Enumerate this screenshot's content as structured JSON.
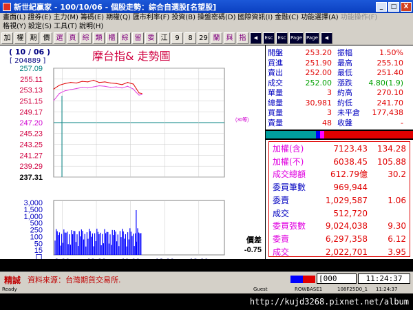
{
  "window": {
    "title": "新世紀贏家 - 100/10/06 - 個股走勢：綜合自選股[名望股]",
    "min": "_",
    "max": "□",
    "close": "X"
  },
  "menu": {
    "row1": [
      "畫面(L)",
      "證券(E)",
      "主力(M)",
      "籌碼(E)",
      "期權(Q)",
      "匯市利率(F)",
      "投資(B)",
      "操盤密碼(D)",
      "國際資訊(I)",
      "金融(C)",
      "功能選擇(A)",
      "功能操作(F)"
    ],
    "row2": [
      "格視(Y)",
      "設定(S)",
      "工具(T)",
      "說明(H)"
    ]
  },
  "toolbar": [
    "加",
    "權",
    "期",
    "價",
    "選",
    "頁",
    "綜",
    "類",
    "櫃",
    "綜",
    "留",
    "委",
    "江",
    "9",
    "8",
    "29",
    "蘭",
    "與",
    "指",
    "◀",
    "Esc",
    "Esc",
    "Page",
    "Page",
    "◀"
  ],
  "chart_header": {
    "date": "( 10 / 06 )",
    "code": "[ 204889 ]",
    "title": "摩台指&  走勢圖",
    "diff_label": "價差",
    "diff_value": "-0.75",
    "ref_label": "(30等)",
    "footer_left": "精誠"
  },
  "chart_data": {
    "type": "line",
    "title": "摩台指&  走勢圖",
    "ylabel": "",
    "xlabel": "",
    "ylim": [
      237.31,
      257.09
    ],
    "y_ticks": [
      "257.09",
      "255.11",
      "253.13",
      "251.15",
      "249.17",
      "247.20",
      "245.23",
      "243.25",
      "241.27",
      "239.29",
      "237.31"
    ],
    "reference": 247.2,
    "x_ticks": [
      "9:00",
      "10:00",
      "11:00",
      "12:00",
      "13:00"
    ],
    "x_range": [
      "8:45",
      "13:45"
    ],
    "series": [
      {
        "x": [
          "8:45",
          "8:55",
          "9:05",
          "9:15",
          "9:25",
          "9:35",
          "9:45",
          "9:55",
          "10:05",
          "10:15",
          "10:25",
          "10:35",
          "10:45",
          "10:55",
          "11:05",
          "11:10",
          "11:15",
          "11:20"
        ],
        "values": [
          253.3,
          254.0,
          254.3,
          254.5,
          254.4,
          254.7,
          254.6,
          254.9,
          254.5,
          254.6,
          254.4,
          254.3,
          254.1,
          254.5,
          254.2,
          253.4,
          252.6,
          252.5
        ],
        "color": "#e00000"
      },
      {
        "x": [
          "8:45",
          "8:55",
          "9:05",
          "9:15",
          "9:25",
          "9:35",
          "9:45",
          "9:55",
          "10:05",
          "10:15",
          "10:25",
          "10:35",
          "10:45",
          "10:55",
          "11:05",
          "11:10",
          "11:15",
          "11:20"
        ],
        "values": [
          251.2,
          252.5,
          253.0,
          253.2,
          253.4,
          253.6,
          253.5,
          253.7,
          253.9,
          253.8,
          253.6,
          253.7,
          253.5,
          253.8,
          253.3,
          252.7,
          252.2,
          252.3
        ],
        "color": "#e040e0"
      }
    ],
    "volume": {
      "y_ticks": [
        "3,000",
        "1,500",
        "1,000",
        "500",
        "250",
        "100",
        "50",
        "15",
        "口"
      ],
      "series_color": "#0000ff"
    }
  },
  "quote": {
    "rows": [
      {
        "l1": "開盤",
        "v1": "253.20",
        "l2": "振幅",
        "v2": "1.50%",
        "c": "#e00000"
      },
      {
        "l1": "買進",
        "v1": "251.90",
        "l2": "最高",
        "v2": "255.10",
        "c": "#e00000"
      },
      {
        "l1": "賣出",
        "v1": "252.00",
        "l2": "最低",
        "v2": "251.40",
        "c": "#e00000"
      },
      {
        "l1": "成交",
        "v1": "252.00",
        "l2": "漲跌",
        "v2": "4.80(1.9)",
        "c": "#00a000"
      },
      {
        "l1": "單量",
        "v1": "3",
        "l2": "約高",
        "v2": "270.10",
        "c": "#e00000"
      },
      {
        "l1": "總量",
        "v1": "30,981",
        "l2": "約低",
        "v2": "241.70",
        "c": "#e00000"
      },
      {
        "l1": "買量",
        "v1": "3",
        "l2": "未平倉",
        "v2": "177,438",
        "c": "#e00000"
      },
      {
        "l1": "賣量",
        "v1": "48",
        "l2": "收盤",
        "v2": "-",
        "c": "#e00000"
      }
    ],
    "index_rows": [
      {
        "label": "加權(含)",
        "value": "7123.43",
        "extra": "134.28",
        "label_color": "#e000e0"
      },
      {
        "label": "加權(不)",
        "value": "6038.45",
        "extra": "105.88",
        "label_color": "#e000e0"
      },
      {
        "label": "成交總額",
        "value": "612.79億",
        "extra": "30.2",
        "label_color": "#e000e0"
      },
      {
        "label": "委買筆數",
        "value": "969,944",
        "extra": "",
        "label_color": "#0000c0"
      },
      {
        "label": "委賣",
        "value": "1,029,587",
        "extra": "1.06",
        "label_color": "#0000c0"
      },
      {
        "label": "成交",
        "value": "512,720",
        "extra": "",
        "label_color": "#0000c0"
      },
      {
        "label": "委買張數",
        "value": "9,024,038",
        "extra": "9.30",
        "label_color": "#e000e0"
      },
      {
        "label": "委賣",
        "value": "6,297,358",
        "extra": "6.12",
        "label_color": "#e000e0"
      },
      {
        "label": "成交",
        "value": "2,022,701",
        "extra": "3.95",
        "label_color": "#e000e0"
      }
    ]
  },
  "status": {
    "source": "資料來源：台灣期貨交易所.",
    "input": "000",
    "clock": "11:24:37"
  },
  "winstatus": {
    "ready": "Ready",
    "user": "Guest",
    "server": "ROWBASE1",
    "code": "108F25D0_1",
    "time": "11:24:37"
  },
  "watermark": "http://kujd3268.pixnet.net/album"
}
